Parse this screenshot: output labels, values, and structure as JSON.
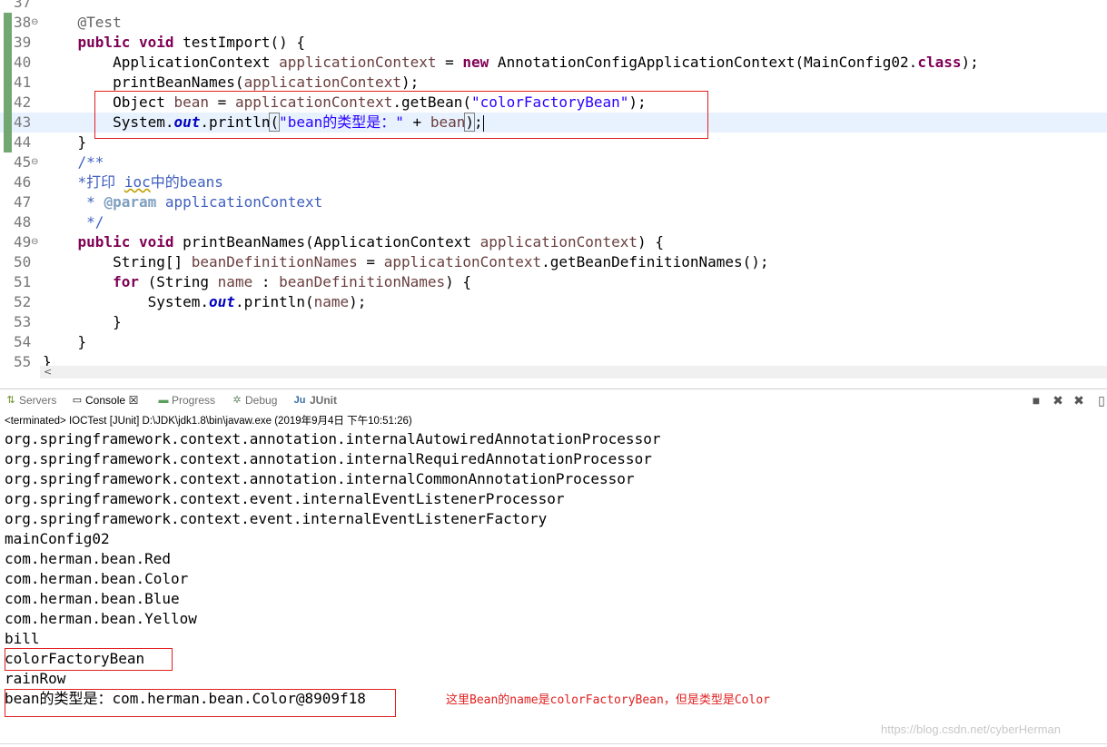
{
  "editor": {
    "lines": [
      {
        "num": "37",
        "fold": "",
        "changed": false
      },
      {
        "num": "38",
        "fold": "⊖",
        "changed": true,
        "parts": [
          {
            "t": "    "
          },
          {
            "c": "ann",
            "t": "@Test"
          }
        ]
      },
      {
        "num": "39",
        "fold": "",
        "changed": true,
        "parts": [
          {
            "t": "    "
          },
          {
            "c": "kw",
            "t": "public"
          },
          {
            "t": " "
          },
          {
            "c": "kw",
            "t": "void"
          },
          {
            "t": " testImport() {"
          }
        ]
      },
      {
        "num": "40",
        "fold": "",
        "changed": true,
        "parts": [
          {
            "t": "        ApplicationContext "
          },
          {
            "c": "var",
            "t": "applicationContext"
          },
          {
            "t": " = "
          },
          {
            "c": "kw",
            "t": "new"
          },
          {
            "t": " AnnotationConfigApplicationContext(MainConfig02."
          },
          {
            "c": "kw",
            "t": "class"
          },
          {
            "t": ");"
          }
        ]
      },
      {
        "num": "41",
        "fold": "",
        "changed": true,
        "parts": [
          {
            "t": "        printBeanNames("
          },
          {
            "c": "var",
            "t": "applicationContext"
          },
          {
            "t": ");"
          }
        ]
      },
      {
        "num": "42",
        "fold": "",
        "changed": true,
        "parts": [
          {
            "t": "        Object "
          },
          {
            "c": "var",
            "t": "bean"
          },
          {
            "t": " = "
          },
          {
            "c": "var",
            "t": "applicationContext"
          },
          {
            "t": ".getBean("
          },
          {
            "c": "str",
            "t": "\"colorFactoryBean\""
          },
          {
            "t": ");"
          }
        ]
      },
      {
        "num": "43",
        "fold": "",
        "changed": true,
        "current": true,
        "parts": [
          {
            "t": "        System."
          },
          {
            "c": "fld",
            "t": "out"
          },
          {
            "t": ".println"
          },
          {
            "c": "paren-box",
            "t": "("
          },
          {
            "c": "str",
            "t": "\"bean的类型是：\""
          },
          {
            "t": " + "
          },
          {
            "c": "var",
            "t": "bean"
          },
          {
            "c": "paren-box",
            "t": ")"
          },
          {
            "t": ";"
          },
          {
            "c": "caret",
            "t": ""
          }
        ]
      },
      {
        "num": "44",
        "fold": "",
        "changed": true,
        "parts": [
          {
            "t": "    }"
          }
        ]
      },
      {
        "num": "45",
        "fold": "⊖",
        "changed": false,
        "parts": [
          {
            "t": "    "
          },
          {
            "c": "jdoc",
            "t": "/**"
          }
        ]
      },
      {
        "num": "46",
        "fold": "",
        "changed": false,
        "parts": [
          {
            "t": "    "
          },
          {
            "c": "jdoc",
            "t": "*打印 "
          },
          {
            "c": "jdoc squiggle",
            "t": "ioc"
          },
          {
            "c": "jdoc",
            "t": "中的beans"
          }
        ]
      },
      {
        "num": "47",
        "fold": "",
        "changed": false,
        "parts": [
          {
            "t": "     "
          },
          {
            "c": "jdoc",
            "t": "* "
          },
          {
            "c": "jtag",
            "t": "@param"
          },
          {
            "c": "jdoc",
            "t": " applicationContext"
          }
        ]
      },
      {
        "num": "48",
        "fold": "",
        "changed": false,
        "parts": [
          {
            "t": "     "
          },
          {
            "c": "jdoc",
            "t": "*/"
          }
        ]
      },
      {
        "num": "49",
        "fold": "⊖",
        "changed": false,
        "parts": [
          {
            "t": "    "
          },
          {
            "c": "kw",
            "t": "public"
          },
          {
            "t": " "
          },
          {
            "c": "kw",
            "t": "void"
          },
          {
            "t": " printBeanNames(ApplicationContext "
          },
          {
            "c": "var",
            "t": "applicationContext"
          },
          {
            "t": ") {"
          }
        ]
      },
      {
        "num": "50",
        "fold": "",
        "changed": false,
        "parts": [
          {
            "t": "        String[] "
          },
          {
            "c": "var",
            "t": "beanDefinitionNames"
          },
          {
            "t": " = "
          },
          {
            "c": "var",
            "t": "applicationContext"
          },
          {
            "t": ".getBeanDefinitionNames();"
          }
        ]
      },
      {
        "num": "51",
        "fold": "",
        "changed": false,
        "parts": [
          {
            "t": "        "
          },
          {
            "c": "kw",
            "t": "for"
          },
          {
            "t": " (String "
          },
          {
            "c": "var",
            "t": "name"
          },
          {
            "t": " : "
          },
          {
            "c": "var",
            "t": "beanDefinitionNames"
          },
          {
            "t": ") {"
          }
        ]
      },
      {
        "num": "52",
        "fold": "",
        "changed": false,
        "parts": [
          {
            "t": "            System."
          },
          {
            "c": "fld",
            "t": "out"
          },
          {
            "t": ".println("
          },
          {
            "c": "var",
            "t": "name"
          },
          {
            "t": ");"
          }
        ]
      },
      {
        "num": "53",
        "fold": "",
        "changed": false,
        "parts": [
          {
            "t": "        }"
          }
        ]
      },
      {
        "num": "54",
        "fold": "",
        "changed": false,
        "parts": [
          {
            "t": "    }"
          }
        ]
      },
      {
        "num": "55",
        "fold": "",
        "changed": false,
        "parts": [
          {
            "t": "}"
          }
        ]
      }
    ],
    "scroll_arrow": "<"
  },
  "views": {
    "tabs": [
      {
        "id": "servers",
        "icon": "servers-icon",
        "glyph": "⇅",
        "label": "Servers",
        "active": false
      },
      {
        "id": "console",
        "icon": "console-icon",
        "glyph": "▭",
        "label": "Console",
        "active": true,
        "close": "☒"
      },
      {
        "id": "progress",
        "icon": "progress-icon",
        "glyph": "▬",
        "label": "Progress",
        "active": false
      },
      {
        "id": "debug",
        "icon": "debug-icon",
        "glyph": "✲",
        "label": "Debug",
        "active": false
      },
      {
        "id": "junit",
        "icon": "junit-icon",
        "glyph": "Ju",
        "label": "JUnit",
        "active": false
      }
    ],
    "tools": [
      {
        "id": "stop",
        "icon": "stop-icon",
        "glyph": "■"
      },
      {
        "id": "remove-launch",
        "icon": "remove-launch-icon",
        "glyph": "✖"
      },
      {
        "id": "remove-all",
        "icon": "remove-all-terminated-icon",
        "glyph": "✖"
      },
      {
        "id": "display-console",
        "icon": "display-console-icon",
        "glyph": "▯"
      }
    ]
  },
  "terminated": "<terminated> IOCTest [JUnit] D:\\JDK\\jdk1.8\\bin\\javaw.exe (2019年9月4日 下午10:51:26)",
  "console": {
    "lines": [
      "org.springframework.context.annotation.internalAutowiredAnnotationProcessor",
      "org.springframework.context.annotation.internalRequiredAnnotationProcessor",
      "org.springframework.context.annotation.internalCommonAnnotationProcessor",
      "org.springframework.context.event.internalEventListenerProcessor",
      "org.springframework.context.event.internalEventListenerFactory",
      "mainConfig02",
      "com.herman.bean.Red",
      "com.herman.bean.Color",
      "com.herman.bean.Blue",
      "com.herman.bean.Yellow",
      "bill",
      "colorFactoryBean",
      "rainRow",
      "bean的类型是：com.herman.bean.Color@8909f18"
    ],
    "note": "这里Bean的name是colorFactoryBean，但是类型是Color"
  },
  "watermark": "https://blog.csdn.net/cyberHerman",
  "colors": {
    "annotation_red": "#e02020",
    "change_bar": "#72a672",
    "current_line": "#e8f2fe"
  }
}
